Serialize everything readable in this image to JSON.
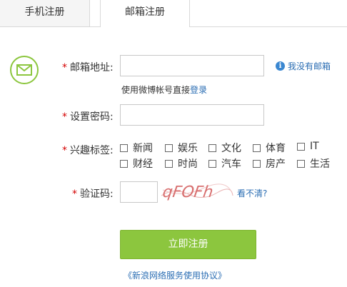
{
  "tabs": [
    {
      "label": "手机注册",
      "active": false
    },
    {
      "label": "邮箱注册",
      "active": true
    }
  ],
  "form": {
    "email": {
      "label": "邮箱地址:",
      "value": "",
      "help": "我没有邮箱",
      "help_icon": "info-icon"
    },
    "weibo": {
      "text": "使用微博帐号直接",
      "link": "登录"
    },
    "password": {
      "label": "设置密码:",
      "value": ""
    },
    "interests": {
      "label": "兴趣标签:",
      "options": [
        "新闻",
        "娱乐",
        "文化",
        "体育",
        "IT",
        "财经",
        "时尚",
        "汽车",
        "房产",
        "生活"
      ]
    },
    "captcha": {
      "label": "验证码:",
      "value": "",
      "image_text": "qFOFh",
      "refresh": "看不清?"
    },
    "submit": "立即注册",
    "agreement": "《新浪网络服务使用协议》"
  },
  "colors": {
    "accent": "#8cc63e",
    "link": "#2a6db3",
    "required": "#d40000"
  }
}
